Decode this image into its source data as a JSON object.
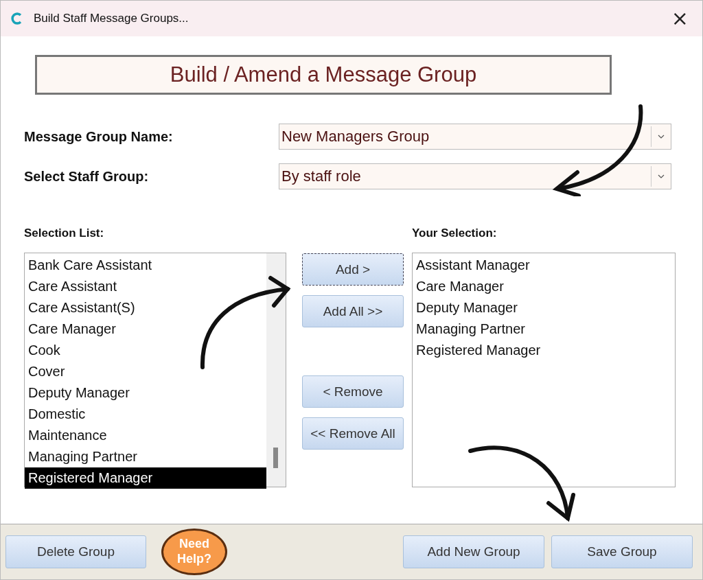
{
  "window": {
    "title": "Build Staff Message Groups...",
    "close": "×"
  },
  "banner": "Build / Amend a Message Group",
  "fields": [
    {
      "label": "Message Group Name:",
      "value": "New Managers Group"
    },
    {
      "label": "Select Staff Group:",
      "value": "By staff role"
    }
  ],
  "selection_list": {
    "label": "Selection List:",
    "items": [
      {
        "text": "Bank Care Assistant",
        "selected": false
      },
      {
        "text": "Care Assistant",
        "selected": false
      },
      {
        "text": "Care Assistant(S)",
        "selected": false
      },
      {
        "text": "Care Manager",
        "selected": false
      },
      {
        "text": "Cook",
        "selected": false
      },
      {
        "text": "Cover",
        "selected": false
      },
      {
        "text": "Deputy Manager",
        "selected": false
      },
      {
        "text": "Domestic",
        "selected": false
      },
      {
        "text": "Maintenance",
        "selected": false
      },
      {
        "text": "Managing Partner",
        "selected": false
      },
      {
        "text": "Registered Manager",
        "selected": true
      }
    ]
  },
  "move_buttons": [
    {
      "label": "Add >",
      "focused": true
    },
    {
      "label": "Add All >>",
      "focused": false
    },
    {
      "label": "< Remove",
      "focused": false
    },
    {
      "label": "<< Remove All",
      "focused": false
    }
  ],
  "your_selection": {
    "label": "Your Selection:",
    "items": [
      "Assistant Manager",
      "Care Manager",
      "Deputy Manager",
      "Managing Partner",
      "Registered Manager"
    ]
  },
  "footer": {
    "delete": "Delete Group",
    "help": "Need Help?",
    "add_new": "Add New Group",
    "save": "Save Group"
  }
}
